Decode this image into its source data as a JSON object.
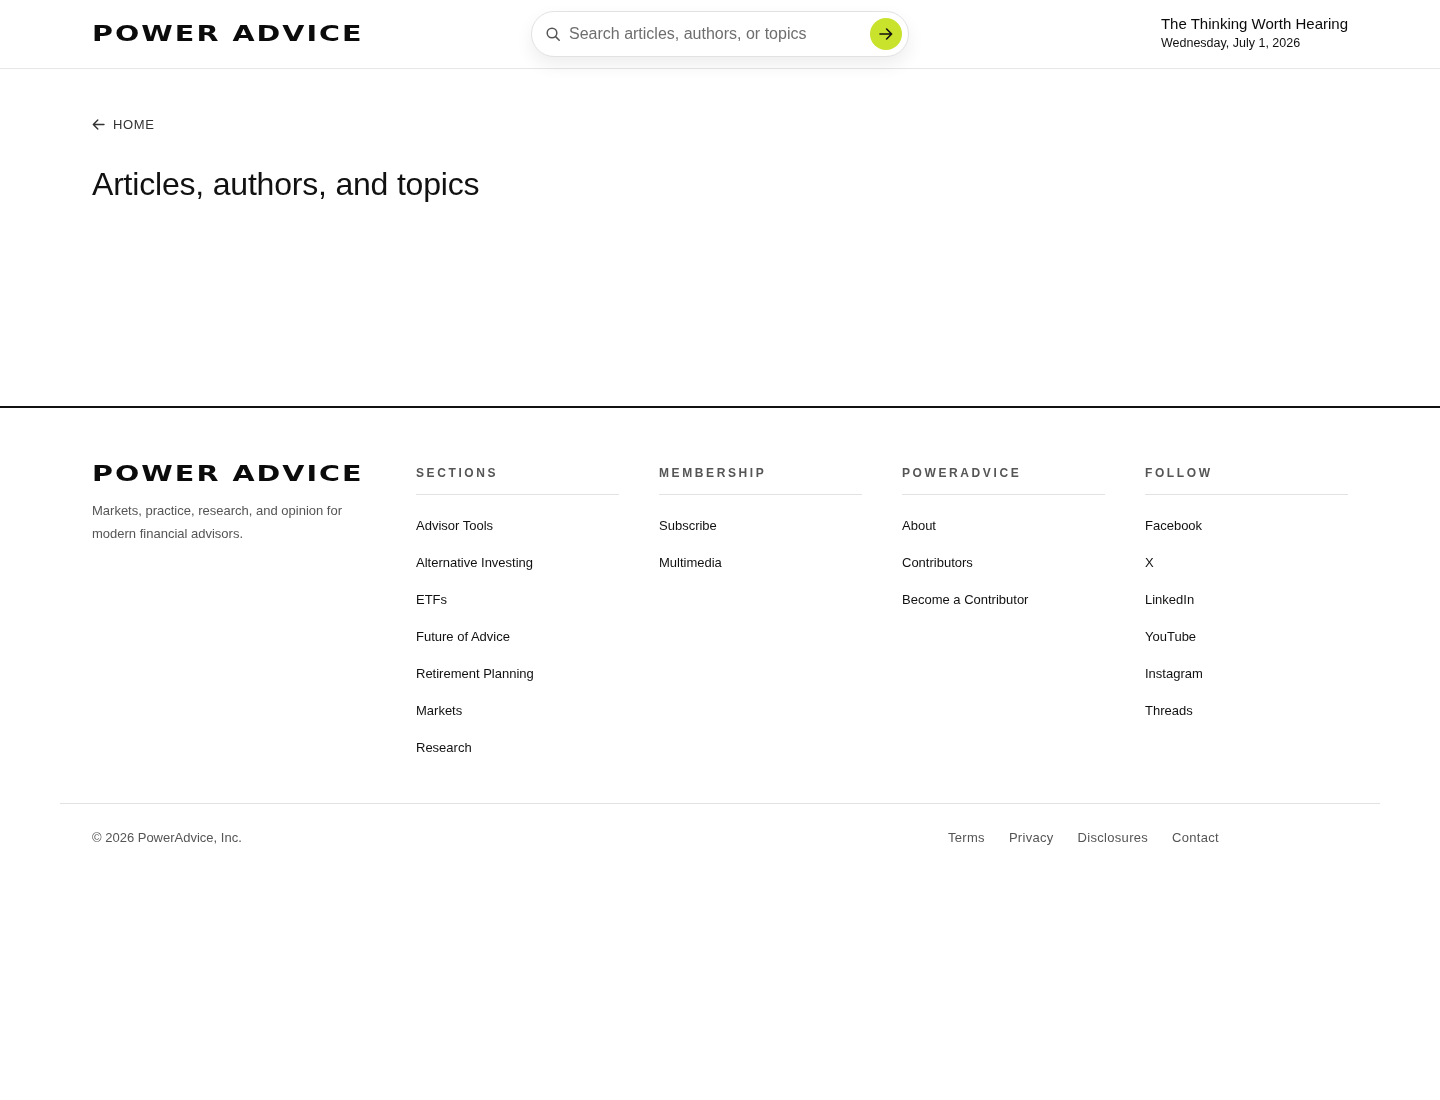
{
  "header": {
    "logo": "POWER ADVICE",
    "search": {
      "placeholder": "Search articles, authors, or topics"
    },
    "tagline": "The Thinking Worth Hearing",
    "date": "Wednesday, July 1, 2026"
  },
  "breadcrumb": {
    "label": "HOME"
  },
  "page_title": "Articles, authors, and topics",
  "footer": {
    "logo": "POWER ADVICE",
    "description": "Markets, practice, research, and opinion for modern financial advisors.",
    "columns": [
      {
        "heading": "SECTIONS",
        "links": [
          "Advisor Tools",
          "Alternative Investing",
          "ETFs",
          "Future of Advice",
          "Retirement Planning",
          "Markets",
          "Research"
        ]
      },
      {
        "heading": "MEMBERSHIP",
        "links": [
          "Subscribe",
          "Multimedia"
        ]
      },
      {
        "heading": "POWERADVICE",
        "links": [
          "About",
          "Contributors",
          "Become a Contributor"
        ]
      },
      {
        "heading": "FOLLOW",
        "links": [
          "Facebook",
          "X",
          "LinkedIn",
          "YouTube",
          "Instagram",
          "Threads"
        ]
      }
    ],
    "copyright": "© 2026 PowerAdvice, Inc.",
    "legal_links": [
      "Terms",
      "Privacy",
      "Disclosures",
      "Contact"
    ]
  }
}
